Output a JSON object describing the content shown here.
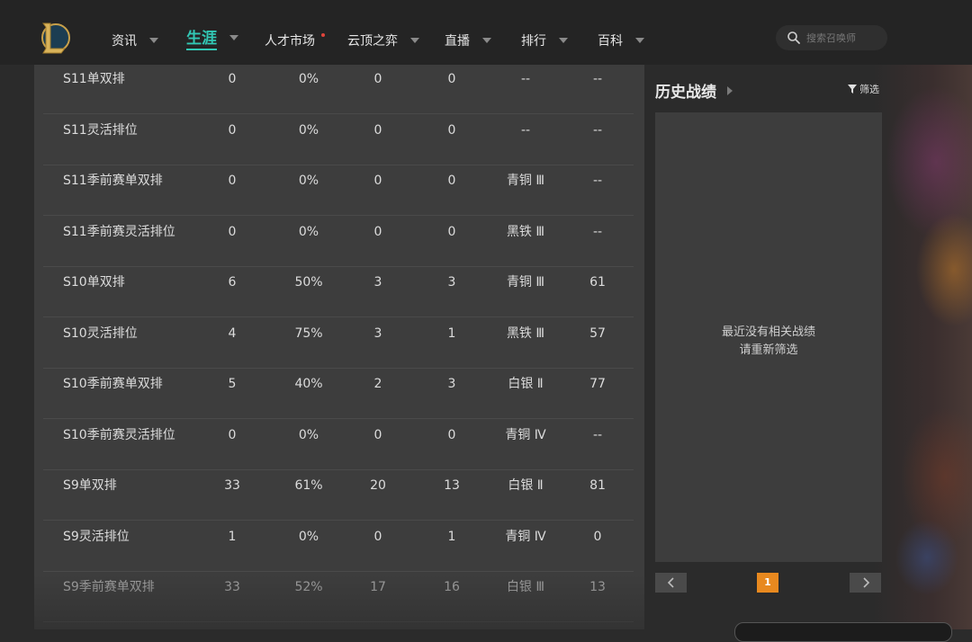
{
  "nav": {
    "items": [
      {
        "label": "资讯",
        "has_caret": true
      },
      {
        "label": "生涯",
        "has_caret": true,
        "active": true
      },
      {
        "label": "人才市场",
        "has_dot": true
      },
      {
        "label": "云顶之弈",
        "has_caret": true
      },
      {
        "label": "直播",
        "has_caret": true
      },
      {
        "label": "排行",
        "has_caret": true
      },
      {
        "label": "百科",
        "has_caret": true
      }
    ],
    "search_placeholder": "搜索召唤师"
  },
  "table": {
    "rows": [
      {
        "name": "S11单双排",
        "c1": "0",
        "c2": "0%",
        "c3": "0",
        "c4": "0",
        "rank": "--",
        "c6": "--"
      },
      {
        "name": "S11灵活排位",
        "c1": "0",
        "c2": "0%",
        "c3": "0",
        "c4": "0",
        "rank": "--",
        "c6": "--"
      },
      {
        "name": "S11季前赛单双排",
        "c1": "0",
        "c2": "0%",
        "c3": "0",
        "c4": "0",
        "rank": "青铜 Ⅲ",
        "c6": "--"
      },
      {
        "name": "S11季前赛灵活排位",
        "c1": "0",
        "c2": "0%",
        "c3": "0",
        "c4": "0",
        "rank": "黑铁 Ⅲ",
        "c6": "--"
      },
      {
        "name": "S10单双排",
        "c1": "6",
        "c2": "50%",
        "c3": "3",
        "c4": "3",
        "rank": "青铜 Ⅲ",
        "c6": "61"
      },
      {
        "name": "S10灵活排位",
        "c1": "4",
        "c2": "75%",
        "c3": "3",
        "c4": "1",
        "rank": "黑铁 Ⅲ",
        "c6": "57"
      },
      {
        "name": "S10季前赛单双排",
        "c1": "5",
        "c2": "40%",
        "c3": "2",
        "c4": "3",
        "rank": "白银 Ⅱ",
        "c6": "77"
      },
      {
        "name": "S10季前赛灵活排位",
        "c1": "0",
        "c2": "0%",
        "c3": "0",
        "c4": "0",
        "rank": "青铜 Ⅳ",
        "c6": "--"
      },
      {
        "name": "S9单双排",
        "c1": "33",
        "c2": "61%",
        "c3": "20",
        "c4": "13",
        "rank": "白银 Ⅱ",
        "c6": "81"
      },
      {
        "name": "S9灵活排位",
        "c1": "1",
        "c2": "0%",
        "c3": "0",
        "c4": "1",
        "rank": "青铜 Ⅳ",
        "c6": "0"
      },
      {
        "name": "S9季前赛单双排",
        "c1": "33",
        "c2": "52%",
        "c3": "17",
        "c4": "16",
        "rank": "白银 Ⅲ",
        "c6": "13"
      }
    ]
  },
  "history": {
    "title": "历史战绩",
    "filter_label": "筛选",
    "empty_line1": "最近没有相关战绩",
    "empty_line2": "请重新筛选",
    "current_page": "1"
  },
  "colors": {
    "accent": "#32c7b4",
    "page_active": "#e8891f",
    "notify_dot": "#e0443b"
  }
}
